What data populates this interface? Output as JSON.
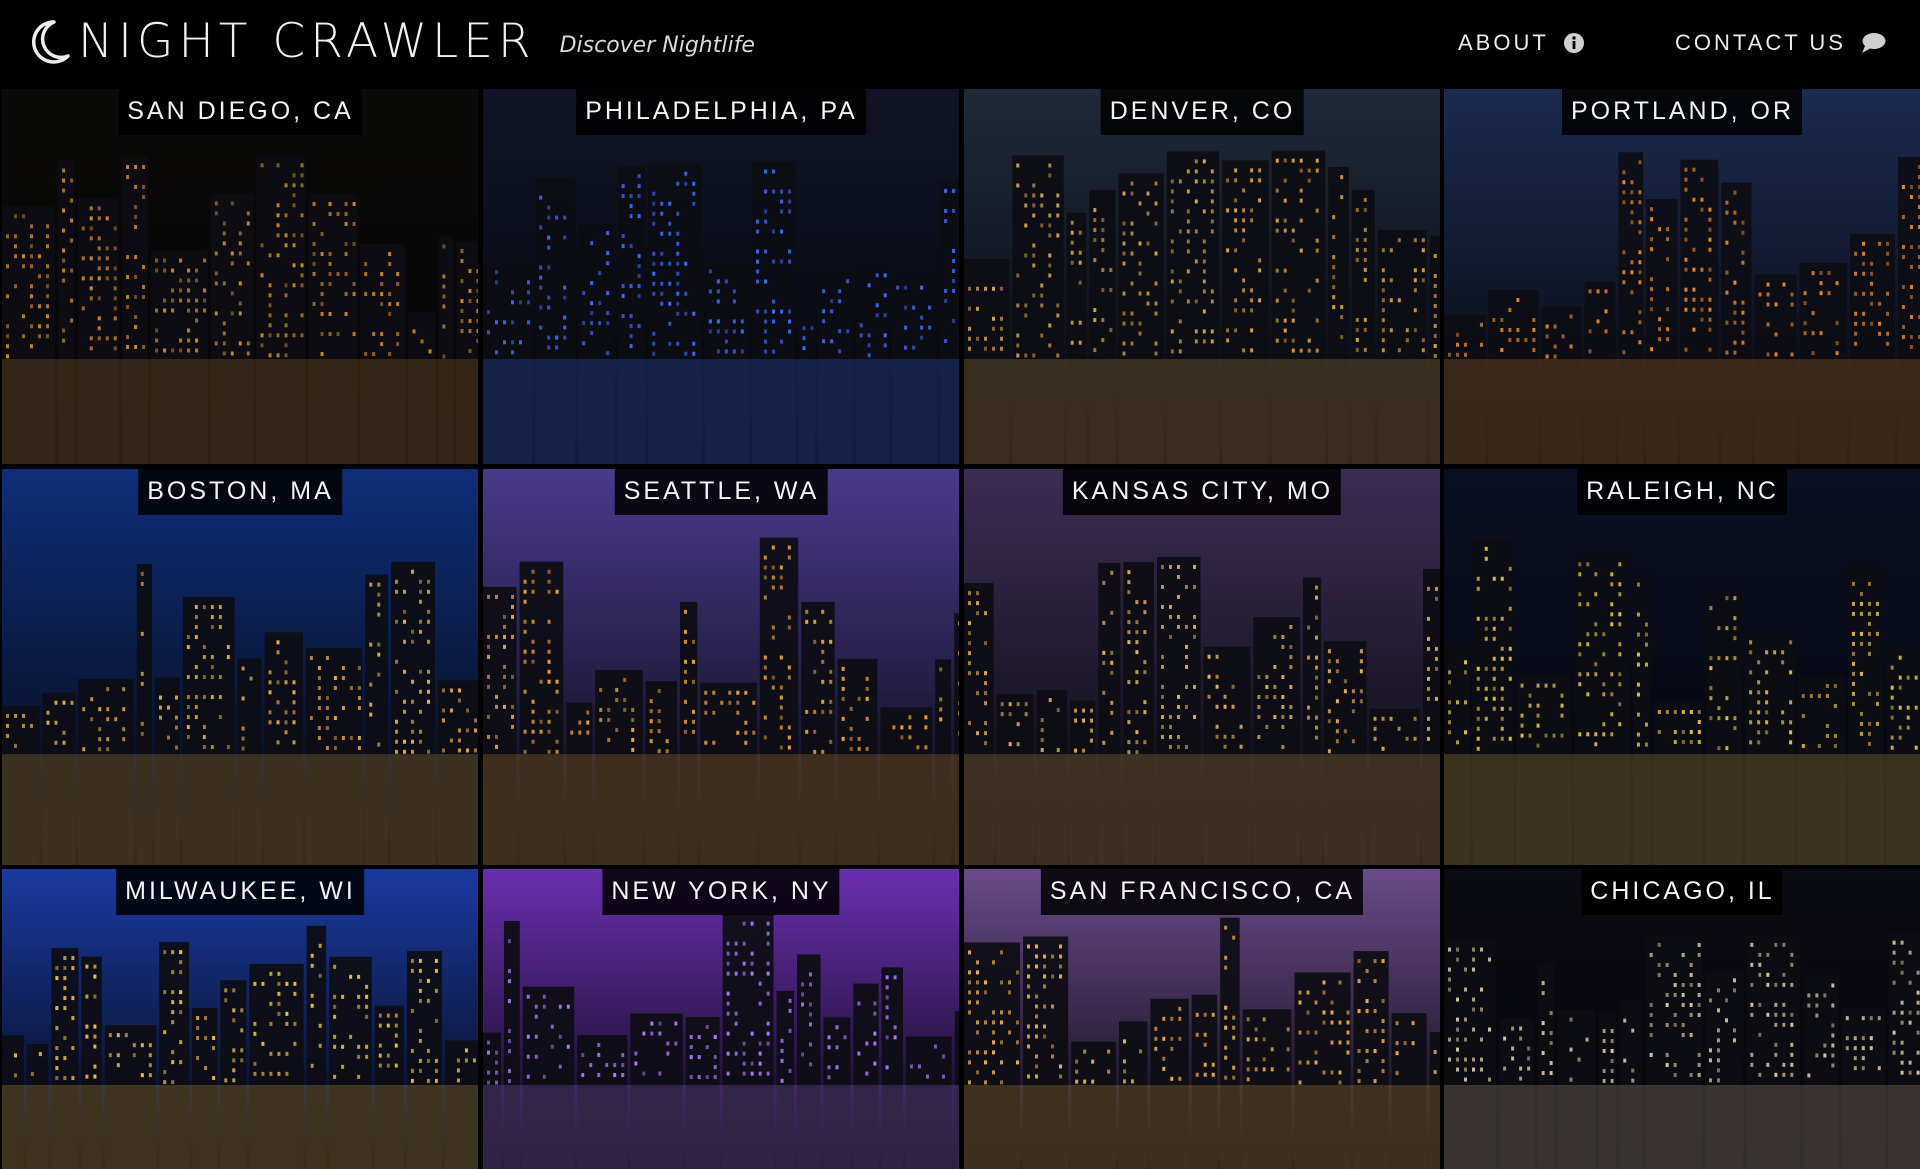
{
  "brand": {
    "title": "NIGHT CRAWLER",
    "tagline": "Discover Nightlife"
  },
  "nav": {
    "about_label": "ABOUT",
    "contact_label": "CONTACT US"
  },
  "icons": {
    "brand": "moon-icon",
    "about": "info-icon",
    "contact": "speech-bubble-icon"
  },
  "cities": [
    {
      "label": "SAN DIEGO, CA",
      "sky": "#0b0a08",
      "glow": "#c98a2a"
    },
    {
      "label": "PHILADELPHIA, PA",
      "sky": "#101426",
      "glow": "#3d6cff"
    },
    {
      "label": "DENVER, CO",
      "sky": "#1f2a3a",
      "glow": "#d8a54a"
    },
    {
      "label": "PORTLAND, OR",
      "sky": "#1b2b4f",
      "glow": "#e58a2e"
    },
    {
      "label": "BOSTON, MA",
      "sky": "#0f2f7a",
      "glow": "#e8b04a"
    },
    {
      "label": "SEATTLE, WA",
      "sky": "#4a3a8c",
      "glow": "#f0a63a"
    },
    {
      "label": "KANSAS CITY, MO",
      "sky": "#3c2d54",
      "glow": "#e7b25a"
    },
    {
      "label": "RALEIGH, NC",
      "sky": "#0a0f24",
      "glow": "#e3c04a"
    },
    {
      "label": "MILWAUKEE, WI",
      "sky": "#1a3aa0",
      "glow": "#f0c04a"
    },
    {
      "label": "NEW YORK, NY",
      "sky": "#6a2fb0",
      "glow": "#b07aff"
    },
    {
      "label": "SAN FRANCISCO, CA",
      "sky": "#6a4a8a",
      "glow": "#f3b04a"
    },
    {
      "label": "CHICAGO, IL",
      "sky": "#0b0b12",
      "glow": "#d9c6a0"
    }
  ]
}
